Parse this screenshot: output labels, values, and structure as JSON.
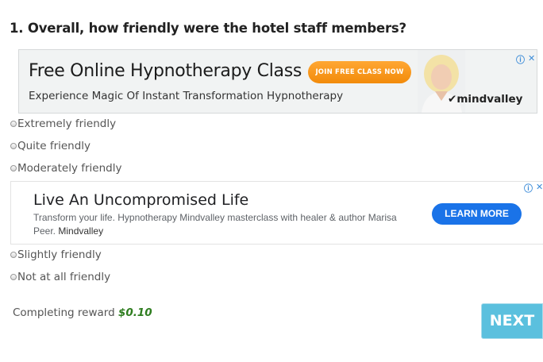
{
  "question": {
    "text": "1. Overall, how friendly were the hotel staff members?"
  },
  "ad_top": {
    "title": "Free Online Hypnotherapy Class",
    "subtitle": "Experience Magic Of Instant Transformation Hypnotherapy",
    "cta": "JOIN FREE CLASS NOW",
    "brand": "mindvalley",
    "choices_icons": [
      "info-icon",
      "close-icon"
    ],
    "accent_color": "#f7941d"
  },
  "options_top": [
    {
      "label": "Extremely friendly"
    },
    {
      "label": "Quite friendly"
    },
    {
      "label": "Moderately friendly"
    }
  ],
  "ad_middle": {
    "title": "Live An Uncompromised Life",
    "description": "Transform your life. Hypnotherapy Mindvalley masterclass with healer & author Marisa Peer.",
    "advertiser": "Mindvalley",
    "cta": "LEARN MORE",
    "cta_color": "#1a73e8"
  },
  "options_bottom": [
    {
      "label": "Slightly friendly"
    },
    {
      "label": "Not at all friendly"
    }
  ],
  "reward": {
    "label": "Completing reward",
    "amount": "$0.10"
  },
  "next_button": {
    "label": "NEXT",
    "color": "#5bc0de"
  }
}
